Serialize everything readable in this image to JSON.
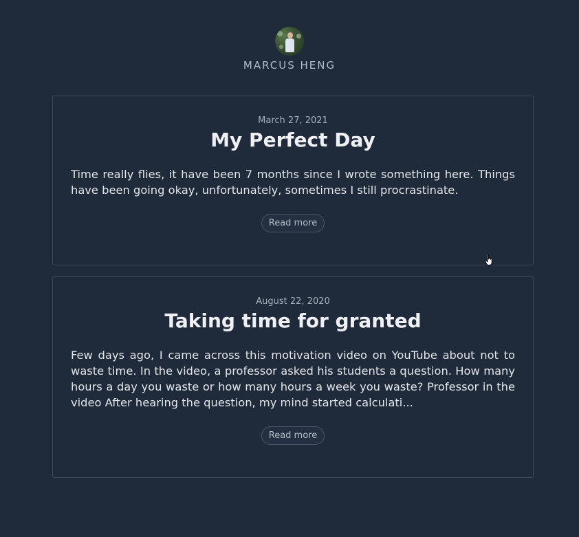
{
  "header": {
    "author_name": "MARCUS HENG"
  },
  "posts": [
    {
      "date": "March 27, 2021",
      "title": "My Perfect Day",
      "excerpt": "Time really flies, it have been 7 months since I wrote something here. Things have been going okay, unfortunately, sometimes I still procrastinate.",
      "read_more_label": "Read more"
    },
    {
      "date": "August 22, 2020",
      "title": "Taking time for granted",
      "excerpt": "Few days ago, I came across this motivation video on YouTube about not to waste time. In the video, a professor asked his students a question. How many hours a day you waste or how many hours a week you waste? Professor in the video After hearing the question, my mind started calculati...",
      "read_more_label": "Read more"
    }
  ],
  "cursor": {
    "icon": "hand-pointer-icon"
  },
  "colors": {
    "background": "#1f2a3a",
    "border": "#3d4858"
  }
}
